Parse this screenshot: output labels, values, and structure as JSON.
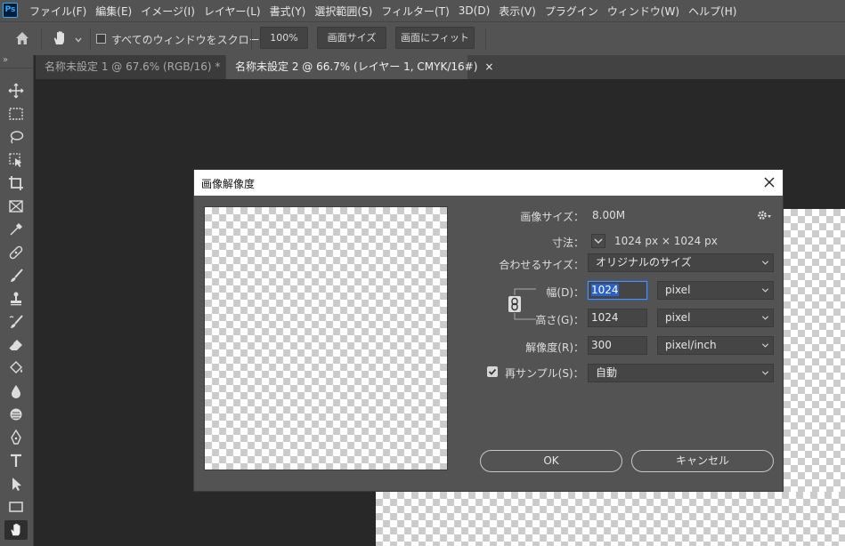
{
  "app": {
    "logo": "Ps"
  },
  "menu": [
    "ファイル(F)",
    "編集(E)",
    "イメージ(I)",
    "レイヤー(L)",
    "書式(Y)",
    "選択範囲(S)",
    "フィルター(T)",
    "3D(D)",
    "表示(V)",
    "プラグイン",
    "ウィンドウ(W)",
    "ヘルプ(H)"
  ],
  "options": {
    "scroll_all_label": "すべてのウィンドウをスクロール",
    "zoom_100": "100%",
    "fit_size": "画面サイズ",
    "fill_screen": "画面にフィット"
  },
  "tabs": [
    {
      "label": "名称未設定 1 @ 67.6% (RGB/16) *",
      "active": false
    },
    {
      "label": "名称未設定 2 @ 66.7% (レイヤー 1, CMYK/16#)",
      "active": true
    }
  ],
  "dialog": {
    "title": "画像解像度",
    "image_size_label": "画像サイズ：",
    "image_size_value": "8.00M",
    "dimensions_label": "寸法：",
    "dimensions_value": "1024 px × 1024 px",
    "fit_to_label": "合わせるサイズ：",
    "fit_to_value": "オリジナルのサイズ",
    "width_label": "幅(D)：",
    "width_value": "1024",
    "width_unit": "pixel",
    "height_label": "高さ(G)：",
    "height_value": "1024",
    "height_unit": "pixel",
    "resolution_label": "解像度(R)：",
    "resolution_value": "300",
    "resolution_unit": "pixel/inch",
    "resample_label": "再サンプル(S)：",
    "resample_checked": true,
    "resample_value": "自動",
    "ok": "OK",
    "cancel": "キャンセル"
  },
  "icons": [
    "ps-logo",
    "home-icon",
    "hand-icon",
    "chevron-down-icon",
    "move-icon",
    "marquee-icon",
    "lasso-icon",
    "object-select-icon",
    "crop-icon",
    "frame-icon",
    "eyedropper-icon",
    "healing-icon",
    "brush-icon",
    "stamp-icon",
    "history-brush-icon",
    "eraser-icon",
    "bucket-icon",
    "blur-icon",
    "dodge-icon",
    "pen-icon",
    "type-icon",
    "path-select-icon",
    "rectangle-icon",
    "hand-icon",
    "close-icon",
    "gear-icon",
    "link-icon",
    "check-icon"
  ]
}
